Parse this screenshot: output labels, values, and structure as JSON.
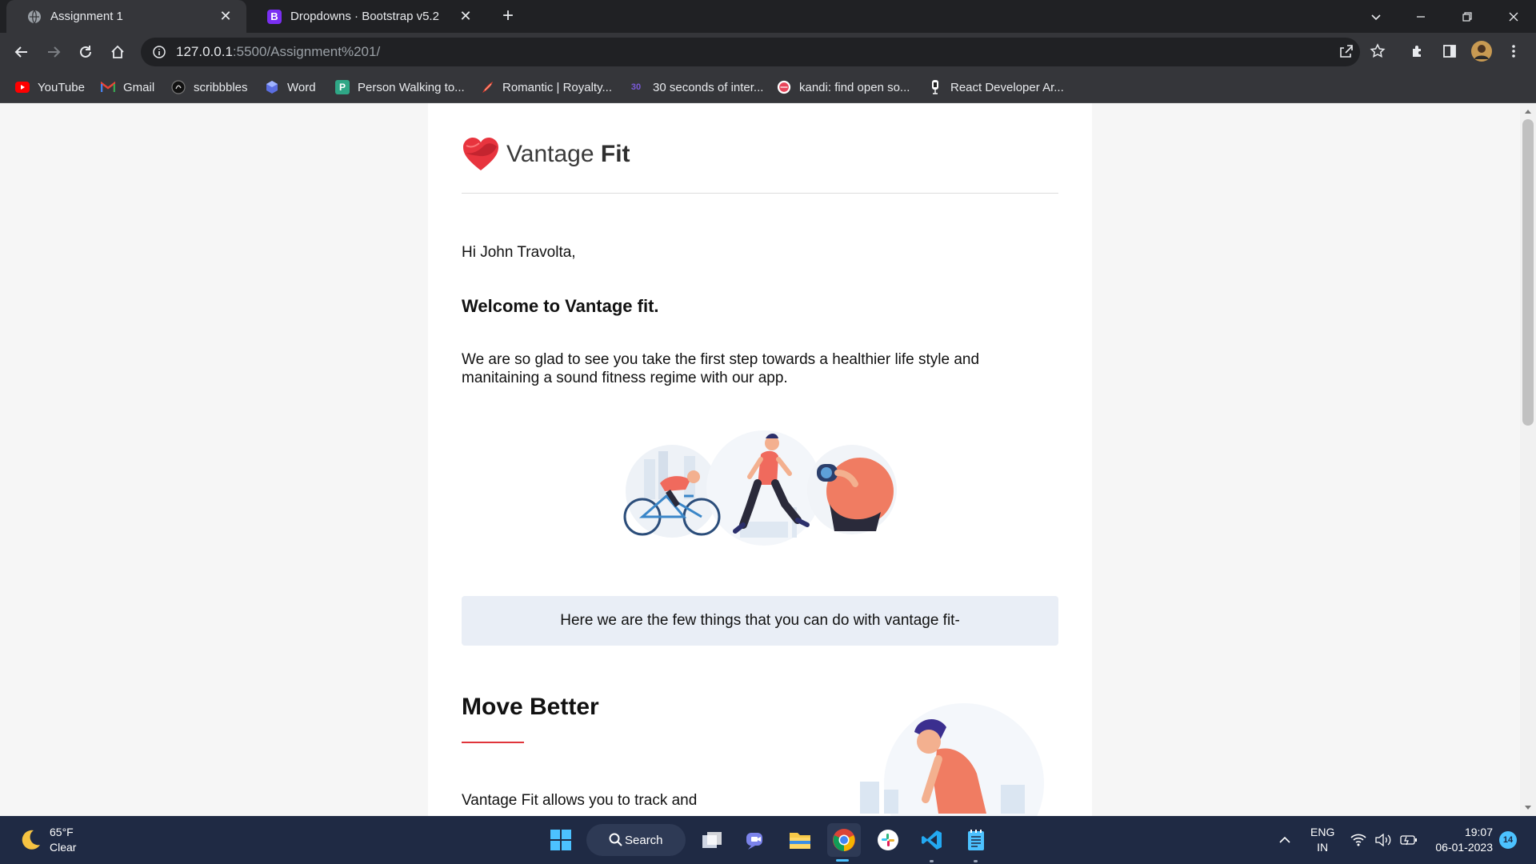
{
  "browser": {
    "tabs": [
      {
        "title": "Assignment 1",
        "active": true,
        "icon": "globe-icon"
      },
      {
        "title": "Dropdowns · Bootstrap v5.2",
        "active": false,
        "icon": "bootstrap-icon",
        "favicon_letter": "B"
      }
    ],
    "url_host": "127.0.0.1",
    "url_path": ":5500/Assignment%201/",
    "bookmarks": [
      {
        "label": "YouTube",
        "icon": "youtube-icon"
      },
      {
        "label": "Gmail",
        "icon": "gmail-icon",
        "letter": "M"
      },
      {
        "label": "scribbbles",
        "icon": "scribbbles-icon"
      },
      {
        "label": "Word",
        "icon": "word-icon"
      },
      {
        "label": "Person Walking to...",
        "icon": "bookmark-p-icon",
        "letter": "P"
      },
      {
        "label": "Romantic | Royalty...",
        "icon": "flame-icon"
      },
      {
        "label": "30 seconds of inter...",
        "icon": "thirty-seconds-icon",
        "letter": "30"
      },
      {
        "label": "kandi: find open so...",
        "icon": "kandi-icon"
      },
      {
        "label": "React Developer Ar...",
        "icon": "react-dev-icon"
      }
    ]
  },
  "email": {
    "brand_light": "Vantage",
    "brand_bold": "Fit",
    "greeting": "Hi John Travolta,",
    "welcome": "Welcome to Vantage fit.",
    "intro": "We are so glad to see you take the first step towards a healthier life style and manitaining a sound fitness regime with our app.",
    "callout": "Here we are the few things that you can do with vantage fit-",
    "section_title": "Move Better",
    "section_text": "Vantage Fit allows you to track and"
  },
  "taskbar": {
    "temperature": "65°F",
    "condition": "Clear",
    "search_label": "Search",
    "lang_1": "ENG",
    "lang_2": "IN",
    "time": "19:07",
    "date": "06-01-2023",
    "notifications": "14"
  },
  "colors": {
    "accent_red": "#e0353b",
    "callout_bg": "#e9eef6",
    "taskbar_bg": "#1f2a44",
    "chrome_bg": "#35363a"
  }
}
